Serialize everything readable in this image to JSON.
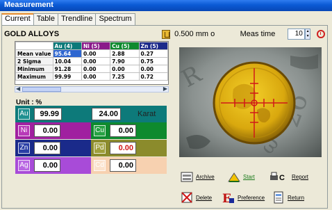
{
  "window": {
    "title": "Measurement"
  },
  "tabs": [
    {
      "label": "Current",
      "active": true
    },
    {
      "label": "Table",
      "active": false
    },
    {
      "label": "Trendline",
      "active": false
    },
    {
      "label": "Spectrum",
      "active": false
    }
  ],
  "header": {
    "alloy_name": "GOLD ALLOYS",
    "filter_value": "0.500 mm o",
    "meas_time_label": "Meas time",
    "meas_time_value": "10"
  },
  "stats": {
    "columns": [
      {
        "label": "Au (4)",
        "color": "#0d7a7a"
      },
      {
        "label": "Ni (5)",
        "color": "#8a1a8a"
      },
      {
        "label": "Cu (5)",
        "color": "#0e8a2e"
      },
      {
        "label": "Zn (5)",
        "color": "#1c2a8a"
      }
    ],
    "rows": [
      {
        "label": "Mean value",
        "values": [
          "95.64",
          "0.00",
          "2.88",
          "0.27"
        ]
      },
      {
        "label": "2 Sigma",
        "values": [
          "10.04",
          "0.00",
          "7.90",
          "0.75"
        ]
      },
      {
        "label": "Minimum",
        "values": [
          "91.28",
          "0.00",
          "0.00",
          "0.00"
        ]
      },
      {
        "label": "Maximum",
        "values": [
          "99.99",
          "0.00",
          "7.25",
          "0.72"
        ]
      }
    ]
  },
  "unit_label": "Unit : %",
  "elements": {
    "au": {
      "symbol": "Au",
      "value": "99.99",
      "karat_value": "24.00",
      "karat_label": "Karat",
      "color": "#0d7a7a"
    },
    "ni": {
      "symbol": "Ni",
      "value": "0.00",
      "color": "#a020a0"
    },
    "cu": {
      "symbol": "Cu",
      "value": "0.00",
      "color": "#0e8a2e"
    },
    "zn": {
      "symbol": "Zn",
      "value": "0.00",
      "color": "#1a2a8a"
    },
    "pd": {
      "symbol": "Pd",
      "value": "0.00",
      "color": "#8b8b2c"
    },
    "ag": {
      "symbol": "Ag",
      "value": "0.00",
      "color": "#a84bd8"
    },
    "cd": {
      "symbol": "Cd",
      "value": "0.00",
      "color": "#f7d1b0"
    }
  },
  "buttons": {
    "archive": "Archive",
    "start": "Start",
    "report": "Report",
    "delete": "Delete",
    "preference": "Preference",
    "return": "Return"
  },
  "icons": {
    "filter": "filter-icon",
    "clock": "clock-icon",
    "archive": "archive-icon",
    "start": "start-icon",
    "report": "printer-icon",
    "delete": "delete-icon",
    "preference": "preference-icon",
    "return": "return-icon"
  }
}
